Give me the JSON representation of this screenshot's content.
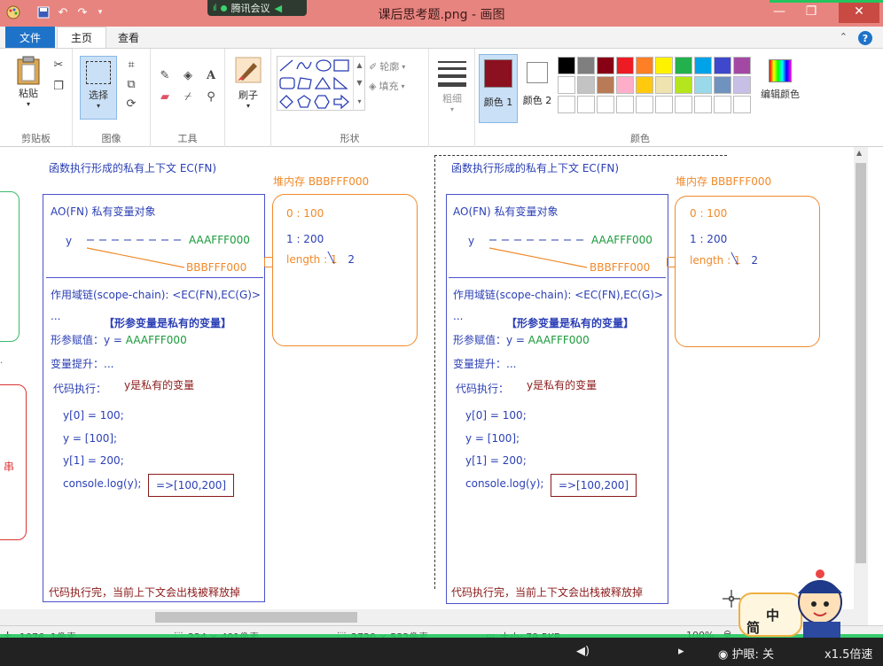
{
  "window": {
    "title": "课后思考题.png - 画图",
    "meeting_label": "腾讯会议"
  },
  "tabs": {
    "file": "文件",
    "home": "主页",
    "view": "查看"
  },
  "ribbon": {
    "clipboard": {
      "paste": "粘贴",
      "group": "剪贴板"
    },
    "image": {
      "select": "选择",
      "group": "图像"
    },
    "tools": {
      "group": "工具"
    },
    "brush": {
      "label": "刷子"
    },
    "shapes": {
      "outline": "轮廓",
      "fill": "填充",
      "group": "形状"
    },
    "size": {
      "label": "粗细"
    },
    "colors": {
      "color1": "颜色 1",
      "color2": "颜色 2",
      "edit": "编辑颜色",
      "group": "颜色",
      "color1_value": "#8b1020",
      "color2_value": "#ffffff",
      "palette": [
        "#000000",
        "#7f7f7f",
        "#880015",
        "#ed1c24",
        "#ff7f27",
        "#fff200",
        "#22b14c",
        "#00a2e8",
        "#3f48cc",
        "#a349a4",
        "#ffffff",
        "#c3c3c3",
        "#b97a57",
        "#ffaec9",
        "#ffc90e",
        "#efe4b0",
        "#b5e61d",
        "#99d9ea",
        "#7092be",
        "#c8bfe7",
        "#ffffff",
        "#ffffff",
        "#ffffff",
        "#ffffff",
        "#ffffff",
        "#ffffff",
        "#ffffff",
        "#ffffff",
        "#ffffff",
        "#ffffff"
      ]
    }
  },
  "diagram": {
    "panels": [
      {
        "ctx_title": "函数执行形成的私有上下文   EC(FN)",
        "ao": "AO(FN)   私有变量对象",
        "var_y": "y",
        "ref1": "AAAFFF000",
        "ref2": "BBBFFF000",
        "scope_chain": "作用域链(scope-chain): <EC(FN),EC(G)>",
        "ellipsis": "...",
        "param_note": "【形参变量是私有的变量】",
        "param_assign_label": "形参赋值：y = ",
        "param_assign_value": "AAAFFF000",
        "hoisting": "变量提升：...",
        "exec_label": "代码执行：",
        "exec_note": "y是私有的变量",
        "code": [
          "y[0] = 100;",
          "y = [100];",
          "y[1] = 200;",
          "console.log(y);"
        ],
        "result": "=>[100,200]",
        "footer": "代码执行完，当前上下文会出栈被释放掉",
        "heap_title": "堆内存 BBBFFF000",
        "heap_lines": [
          "0 : 100",
          "1 : 200"
        ],
        "heap_length_label": "length : ",
        "heap_length_old": "1",
        "heap_length_new": "2"
      },
      {
        "ctx_title": "函数执行形成的私有上下文   EC(FN)",
        "ao": "AO(FN)   私有变量对象",
        "var_y": "y",
        "ref1": "AAAFFF000",
        "ref2": "BBBFFF000",
        "scope_chain": "作用域链(scope-chain): <EC(FN),EC(G)>",
        "ellipsis": "...",
        "param_note": "【形参变量是私有的变量】",
        "param_assign_label": "形参赋值：y = ",
        "param_assign_value": "AAAFFF000",
        "hoisting": "变量提升：...",
        "exec_label": "代码执行：",
        "exec_note": "y是私有的变量",
        "code": [
          "y[0] = 100;",
          "y = [100];",
          "y[1] = 200;",
          "console.log(y);"
        ],
        "result": "=>[100,200]",
        "footer": "代码执行完，当前上下文会出栈被释放掉",
        "heap_title": "堆内存 BBBFFF000",
        "heap_lines": [
          "0 : 100",
          "1 : 200"
        ],
        "heap_length_label": "length : ",
        "heap_length_old": "1",
        "heap_length_new": "2"
      }
    ],
    "left_edge_text": "串"
  },
  "statusbar": {
    "cursor": "1076, 1像素",
    "selection": "224 × 401像素",
    "image_size": "2720 × 532像素",
    "file_size": "大小: 79.5KB",
    "zoom": "100%"
  },
  "player": {
    "label": "护眼: 关",
    "speed": "x1.5倍速"
  },
  "sticker": {
    "top_char": "中",
    "bottom_char": "简"
  }
}
